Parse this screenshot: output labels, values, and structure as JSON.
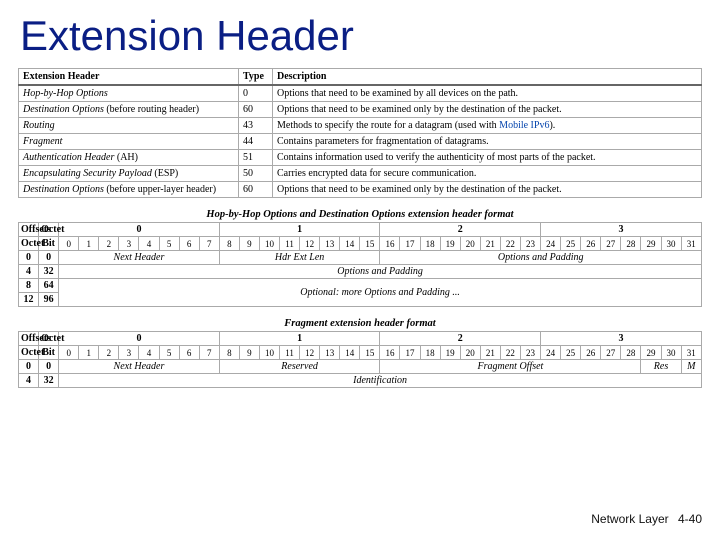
{
  "title": "Extension Header",
  "footer": {
    "label": "Network Layer",
    "page": "4-40"
  },
  "table1": {
    "headers": {
      "eh": "Extension Header",
      "type": "Type",
      "desc": "Description"
    },
    "rows": [
      {
        "eh_html": "<i>Hop-by-Hop Options</i>",
        "type": "0",
        "desc_html": "Options that need to be examined by all devices on the path."
      },
      {
        "eh_html": "<i>Destination Options</i> (before routing header)",
        "type": "60",
        "desc_html": "Options that need to be examined only by the destination of the packet."
      },
      {
        "eh_html": "<i>Routing</i>",
        "type": "43",
        "desc_html": "Methods to specify the route for a datagram (used with <a>Mobile IPv6</a>)."
      },
      {
        "eh_html": "<i>Fragment</i>",
        "type": "44",
        "desc_html": "Contains parameters for fragmentation of datagrams."
      },
      {
        "eh_html": "<i>Authentication Header</i> (AH)",
        "type": "51",
        "desc_html": "Contains information used to verify the authenticity of most parts of the packet."
      },
      {
        "eh_html": "<i>Encapsulating Security Payload</i> (ESP)",
        "type": "50",
        "desc_html": "Carries encrypted data for secure communication."
      },
      {
        "eh_html": "<i>Destination Options</i> (before upper-layer header)",
        "type": "60",
        "desc_html": "Options that need to be examined only by the destination of the packet."
      }
    ]
  },
  "hop_table": {
    "caption": "Hop-by-Hop Options and Destination Options extension header format",
    "labels": {
      "offsets": "Offsets",
      "octet_col": "Octet",
      "octet_row": "Octet",
      "bit": "Bit"
    },
    "octet_groups": [
      "0",
      "1",
      "2",
      "3"
    ],
    "bits": [
      "0",
      "1",
      "2",
      "3",
      "4",
      "5",
      "6",
      "7",
      "8",
      "9",
      "10",
      "11",
      "12",
      "13",
      "14",
      "15",
      "16",
      "17",
      "18",
      "19",
      "20",
      "21",
      "22",
      "23",
      "24",
      "25",
      "26",
      "27",
      "28",
      "29",
      "30",
      "31"
    ],
    "rows": [
      {
        "off": "0",
        "oct": "0",
        "cells": [
          {
            "span": 8,
            "text": "Next Header"
          },
          {
            "span": 8,
            "text": "Hdr Ext Len"
          },
          {
            "span": 16,
            "text": "Options and Padding"
          }
        ]
      },
      {
        "off": "4",
        "oct": "32",
        "cells": [
          {
            "span": 32,
            "text": "Options and Padding"
          }
        ]
      },
      {
        "off": "8",
        "oct": "64",
        "cells": [
          {
            "span": 32,
            "text": "Optional: more Options and Padding ...",
            "rowspan": 2
          }
        ]
      },
      {
        "off": "12",
        "oct": "96",
        "cells": []
      }
    ]
  },
  "frag_table": {
    "caption": "Fragment extension header format",
    "labels": {
      "offsets": "Offsets",
      "octet_col": "Octet",
      "octet_row": "Octet",
      "bit": "Bit"
    },
    "octet_groups": [
      "0",
      "1",
      "2",
      "3"
    ],
    "bits": [
      "0",
      "1",
      "2",
      "3",
      "4",
      "5",
      "6",
      "7",
      "8",
      "9",
      "10",
      "11",
      "12",
      "13",
      "14",
      "15",
      "16",
      "17",
      "18",
      "19",
      "20",
      "21",
      "22",
      "23",
      "24",
      "25",
      "26",
      "27",
      "28",
      "29",
      "30",
      "31"
    ],
    "rows": [
      {
        "off": "0",
        "oct": "0",
        "cells": [
          {
            "span": 8,
            "text": "Next Header"
          },
          {
            "span": 8,
            "text": "Reserved"
          },
          {
            "span": 13,
            "text": "Fragment Offset"
          },
          {
            "span": 2,
            "text": "Res"
          },
          {
            "span": 1,
            "text": "M"
          }
        ]
      },
      {
        "off": "4",
        "oct": "32",
        "cells": [
          {
            "span": 32,
            "text": "Identification"
          }
        ]
      }
    ]
  }
}
